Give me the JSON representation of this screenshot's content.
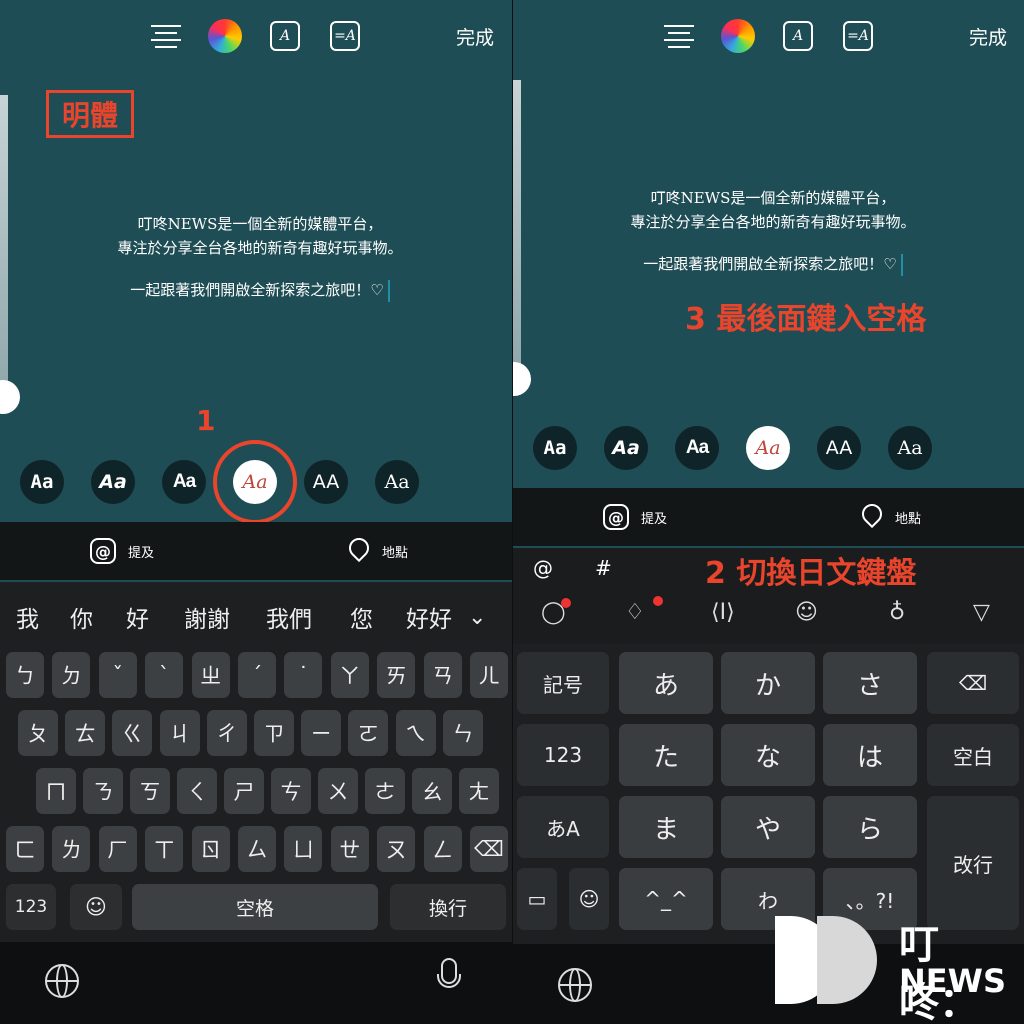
{
  "colors": {
    "story_bg": "#1f4d55",
    "annotation": "#e8452c",
    "keyboard_bg": "#1d1f21",
    "key": "#3d4043"
  },
  "left": {
    "topbar": {
      "align_icon": "text-align-icon",
      "color_icon": "color-wheel-icon",
      "effect_icon": "A-sparkle-icon",
      "anim_icon": "text-animation-icon",
      "effect_glyph": "A",
      "anim_glyph": "=A",
      "done": "完成"
    },
    "label": "明體",
    "story": {
      "line1": "叮咚NEWS是一個全新的媒體平台，",
      "line2": "專注於分享全台各地的新奇有趣好玩事物。",
      "line3": "一起跟著我們開啟全新探索之旅吧！♡"
    },
    "annotation_num": "1",
    "fonts": [
      "Aa",
      "Aa",
      "Aa",
      "Aa",
      "AA",
      "Aa"
    ],
    "mention": "提及",
    "location": "地點",
    "candidates": [
      "我",
      "你",
      "好",
      "謝謝",
      "我們",
      "您",
      "好好"
    ],
    "candidate_toggle": "chevron-down-icon",
    "rows": [
      [
        "ㄅ",
        "ㄉ",
        "ˇ",
        "ˋ",
        "ㄓ",
        "ˊ",
        "˙",
        "ㄚ",
        "ㄞ",
        "ㄢ",
        "ㄦ"
      ],
      [
        "ㄆ",
        "ㄊ",
        "ㄍ",
        "ㄐ",
        "ㄔ",
        "ㄗ",
        "ㄧ",
        "ㄛ",
        "ㄟ",
        "ㄣ"
      ],
      [
        "ㄇ",
        "ㄋ",
        "ㄎ",
        "ㄑ",
        "ㄕ",
        "ㄘ",
        "ㄨ",
        "ㄜ",
        "ㄠ",
        "ㄤ"
      ],
      [
        "ㄈ",
        "ㄌ",
        "ㄏ",
        "ㄒ",
        "ㄖ",
        "ㄙ",
        "ㄩ",
        "ㄝ",
        "ㄡ",
        "ㄥ",
        "⌫"
      ]
    ],
    "bottom": {
      "num": "123",
      "emoji": "☺",
      "space": "空格",
      "enter": "換行"
    }
  },
  "right": {
    "topbar": {
      "done": "完成",
      "effect_glyph": "A",
      "anim_glyph": "=A"
    },
    "story": {
      "line1": "叮咚NEWS是一個全新的媒體平台，",
      "line2": "專注於分享全台各地的新奇有趣好玩事物。",
      "line3": "一起跟著我們開啟全新探索之旅吧！♡"
    },
    "annotation3": "3 最後面鍵入空格",
    "annotation2": "2 切換日文鍵盤",
    "fonts": [
      "Aa",
      "Aa",
      "Aa",
      "Aa",
      "AA",
      "Aa"
    ],
    "mention": "提及",
    "location": "地點",
    "quick": [
      "@",
      "#"
    ],
    "keys": {
      "left": [
        "記号",
        "123",
        "あA"
      ],
      "grid": [
        "あ",
        "か",
        "さ",
        "た",
        "な",
        "は",
        "ま",
        "や",
        "ら",
        "^_^",
        "わ",
        "、。?!"
      ],
      "right": [
        "⌫",
        "空白",
        "改行"
      ]
    }
  },
  "logo": {
    "brand": "叮咚：",
    "sub": "NEWS"
  }
}
